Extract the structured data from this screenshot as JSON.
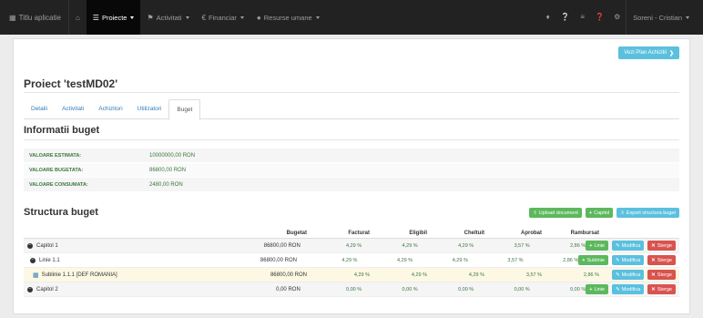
{
  "navbar": {
    "brand": "Titlu aplicatie",
    "menu": [
      {
        "label": "Proiecte",
        "active": true
      },
      {
        "label": "Activitati",
        "active": false
      },
      {
        "label": "Financiar",
        "active": false
      },
      {
        "label": "Resurse umane",
        "active": false
      }
    ],
    "user": "Soreni - Cristian"
  },
  "buttons": {
    "plan": "Vezi Plan Achizitii",
    "upload": "Upload document",
    "capitol": "Capitol",
    "export": "Export structura buget",
    "linie": "Linie",
    "subline": "Sublinie",
    "modifica": "Modifica",
    "sterge": "Sterge"
  },
  "project": {
    "title": "Proiect 'testMD02'"
  },
  "tabs": [
    "Detalii",
    "Activitati",
    "Achizitori",
    "Utilizatori",
    "Buget"
  ],
  "active_tab": "Buget",
  "info": {
    "heading": "Informatii buget",
    "rows": [
      {
        "label": "VALOARE ESTIMATA:",
        "value": "10000000,00 RON"
      },
      {
        "label": "VALOARE BUGETATA:",
        "value": "86800,00 RON"
      },
      {
        "label": "VALOARE CONSUMATA:",
        "value": "2480,00 RON"
      }
    ]
  },
  "structure": {
    "heading": "Structura buget",
    "columns": [
      "Bugetat",
      "Facturat",
      "Eligibil",
      "Cheltuit",
      "Aprobat",
      "Rambursat"
    ],
    "rows": [
      {
        "name": "Capitol 1",
        "bugetat": "86800,00 RON",
        "facturat": "4,29 %",
        "eligibil": "4,29 %",
        "cheltuit": "4,29 %",
        "aprobat": "3,57 %",
        "rambursat": "2,86 %"
      },
      {
        "name": "Linie 1.1",
        "bugetat": "86800,00 RON",
        "facturat": "4,29 %",
        "eligibil": "4,29 %",
        "cheltuit": "4,29 %",
        "aprobat": "3,57 %",
        "rambursat": "2,86 %"
      },
      {
        "name": "Sublinie 1.1.1 [DEF ROMANIA]",
        "bugetat": "86800,00 RON",
        "facturat": "4,29 %",
        "eligibil": "4,29 %",
        "cheltuit": "4,29 %",
        "aprobat": "3,57 %",
        "rambursat": "2,86 %"
      },
      {
        "name": "Capitol 2",
        "bugetat": "0,00 RON",
        "facturat": "0,00 %",
        "eligibil": "0,00 %",
        "cheltuit": "0,00 %",
        "aprobat": "0,00 %",
        "rambursat": "0,00 %"
      }
    ]
  },
  "colors": {
    "navbar": "#222222",
    "success": "#5cb85c",
    "info": "#5bc0de",
    "danger": "#d9534f",
    "green_text": "#3c763d"
  }
}
